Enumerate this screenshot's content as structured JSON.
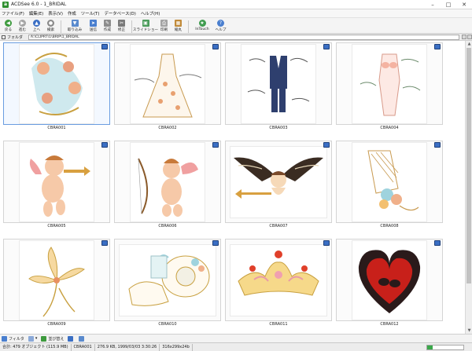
{
  "window": {
    "title": "ACDSee 6.0 - 1_BRIDAL"
  },
  "menu": [
    "ファイル(F)",
    "編集(E)",
    "表示(V)",
    "作成",
    "ツール(T)",
    "データベース(D)",
    "ヘルプ(H)"
  ],
  "toolbar": {
    "buttons": [
      {
        "label": "戻る",
        "icon": "back-icon",
        "color": "#3e9b3e"
      },
      {
        "label": "進む",
        "icon": "forward-icon",
        "color": "#9a9a9a"
      },
      {
        "label": "上へ",
        "icon": "up-icon",
        "color": "#3b6fc4"
      },
      {
        "label": "検索",
        "icon": "search-icon",
        "color": "#888888"
      },
      {
        "label": "取り込み",
        "icon": "import-icon",
        "color": "#5a8acd"
      },
      {
        "label": "送信",
        "icon": "send-icon",
        "color": "#4a7fcf"
      },
      {
        "label": "作成",
        "icon": "create-icon",
        "color": "#8c8c8c"
      },
      {
        "label": "修正",
        "icon": "edit-icon",
        "color": "#7a7a7a"
      },
      {
        "label": "スライドショー",
        "icon": "slideshow-icon",
        "color": "#4c9c5c"
      },
      {
        "label": "印刷",
        "icon": "print-icon",
        "color": "#9a9a9a"
      },
      {
        "label": "縮丸",
        "icon": "shrink-icon",
        "color": "#c18b3a"
      },
      {
        "label": "InTouch",
        "icon": "intouch-icon",
        "color": "#3f9c4f"
      },
      {
        "label": "ヘルプ",
        "icon": "help-icon",
        "color": "#4a7fcf"
      }
    ]
  },
  "path": {
    "folder_label": "フォルダ",
    "value": "A:\\CLIPRT\\1\\BRIP\\1_BRIDAL"
  },
  "thumbnails": [
    {
      "name": "CBRA001",
      "selected": true
    },
    {
      "name": "CBRA002"
    },
    {
      "name": "CBRA003"
    },
    {
      "name": "CBRA004"
    },
    {
      "name": "CBRA005"
    },
    {
      "name": "CBRA006"
    },
    {
      "name": "CBRA007"
    },
    {
      "name": "CBRA008"
    },
    {
      "name": "CBRA009"
    },
    {
      "name": "CBRA010"
    },
    {
      "name": "CBRA011"
    },
    {
      "name": "CBRA012"
    }
  ],
  "bottom_toolbar": {
    "filter_label": "フィルタ",
    "sort_label": "並び替え"
  },
  "status": {
    "total": "合計: 479 オブジェクト (115.9 MB)",
    "selected_file": "CBRA001",
    "file_info": "276.9 KB, 1999/03/03 3:30:26",
    "dimensions": "316x299x24b",
    "progress_fraction": 0.15
  }
}
